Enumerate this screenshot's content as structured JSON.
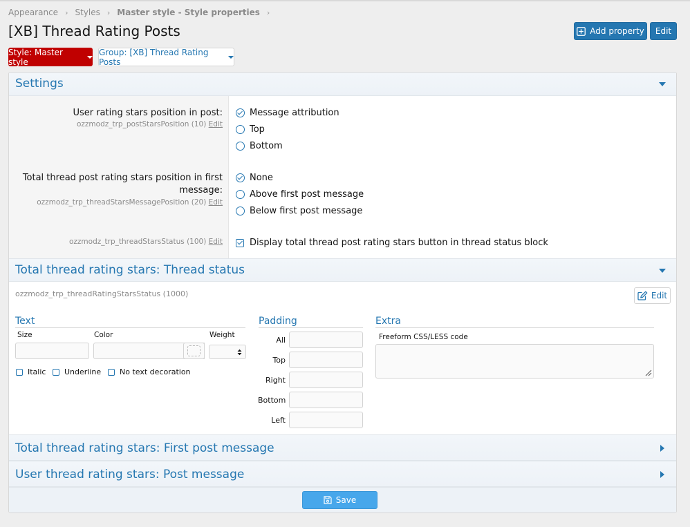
{
  "breadcrumb": [
    "Appearance",
    "Styles",
    "Master style - Style properties"
  ],
  "page_title": "[XB] Thread Rating Posts",
  "buttons": {
    "add_property": "Add property",
    "edit": "Edit",
    "save": "Save"
  },
  "style_selector": "Style: Master style",
  "group_selector": "Group: [XB] Thread Rating Posts",
  "settings": {
    "title": "Settings",
    "post_stars": {
      "label": "User rating stars position in post:",
      "key": "ozzmodz_trp_postStarsPosition (10)",
      "edit": "Edit",
      "options": [
        "Message attribution",
        "Top",
        "Bottom"
      ],
      "selected": 0
    },
    "thread_stars": {
      "label_line1": "Total thread post rating stars position in first",
      "label_line2": "message:",
      "key": "ozzmodz_trp_threadStarsMessagePosition (20)",
      "edit": "Edit",
      "options": [
        "None",
        "Above first post message",
        "Below first post message"
      ],
      "selected": 0
    },
    "thread_status": {
      "key": "ozzmodz_trp_threadStarsStatus (100)",
      "edit": "Edit",
      "checkbox_label": "Display total thread post rating stars button in thread status block",
      "checked": true
    }
  },
  "thread_status_section": {
    "title": "Total thread rating stars: Thread status",
    "key": "ozzmodz_trp_threadRatingStarsStatus (1000)",
    "edit": "Edit",
    "text": {
      "heading": "Text",
      "size": "Size",
      "color": "Color",
      "weight": "Weight",
      "italic": "Italic",
      "underline": "Underline",
      "no_decoration": "No text decoration"
    },
    "padding": {
      "heading": "Padding",
      "all": "All",
      "top": "Top",
      "right": "Right",
      "bottom": "Bottom",
      "left": "Left"
    },
    "extra": {
      "heading": "Extra",
      "freeform": "Freeform CSS/LESS code"
    }
  },
  "collapsed_sections": [
    "Total thread rating stars: First post message",
    "User thread rating stars: Post message"
  ],
  "colors": {
    "accent": "#2577b1",
    "style_button": "#c00000",
    "save_button": "#47a7eb"
  }
}
